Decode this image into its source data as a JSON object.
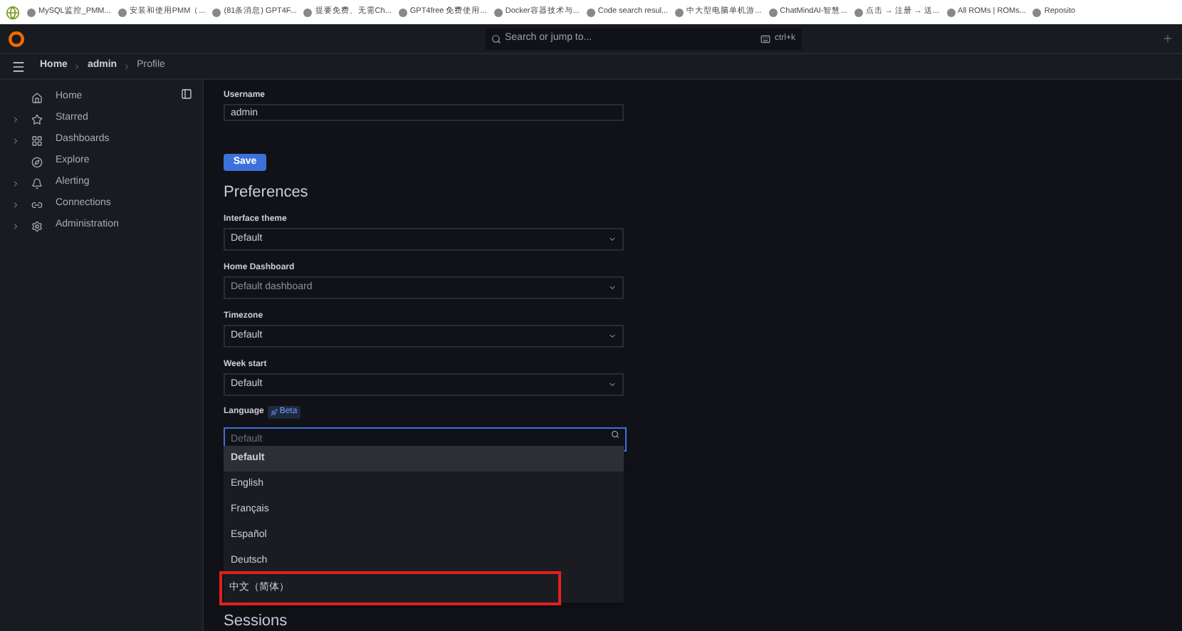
{
  "bookmarks": [
    {
      "label": "MySQL监控_PMM..."
    },
    {
      "label": "安装和使用PMM（..."
    },
    {
      "label": "(81条消息) GPT4F..."
    },
    {
      "label": "提要免费、无需Ch..."
    },
    {
      "label": "GPT4free 免费使用..."
    },
    {
      "label": "Docker容器技术与..."
    },
    {
      "label": "Code search resul..."
    },
    {
      "label": "中大型电脑单机游..."
    },
    {
      "label": "ChatMindAI-智慧..."
    },
    {
      "label": "点击 → 注册 → 送..."
    },
    {
      "label": "All ROMs | ROMs..."
    },
    {
      "label": "Reposito"
    }
  ],
  "search": {
    "placeholder": "Search or jump to...",
    "shortcut": "ctrl+k"
  },
  "breadcrumb": [
    {
      "label": "Home",
      "current": false
    },
    {
      "label": "admin",
      "current": false
    },
    {
      "label": "Profile",
      "current": true
    }
  ],
  "sidebar": {
    "items": [
      {
        "label": "Home",
        "expandable": false
      },
      {
        "label": "Starred",
        "expandable": true
      },
      {
        "label": "Dashboards",
        "expandable": true
      },
      {
        "label": "Explore",
        "expandable": false
      },
      {
        "label": "Alerting",
        "expandable": true
      },
      {
        "label": "Connections",
        "expandable": true
      },
      {
        "label": "Administration",
        "expandable": true
      }
    ]
  },
  "username": {
    "label": "Username",
    "value": "admin"
  },
  "save_button": "Save",
  "preferences": {
    "title": "Preferences",
    "fields": [
      {
        "label": "Interface theme",
        "value": "Default",
        "muted": false
      },
      {
        "label": "Home Dashboard",
        "value": "Default dashboard",
        "muted": true
      },
      {
        "label": "Timezone",
        "value": "Default",
        "muted": false
      },
      {
        "label": "Week start",
        "value": "Default",
        "muted": false
      }
    ]
  },
  "language": {
    "label": "Language",
    "badge": "Beta",
    "placeholder": "Default",
    "options": [
      {
        "label": "Default",
        "selected": true,
        "annotated": false
      },
      {
        "label": "English",
        "selected": false,
        "annotated": false
      },
      {
        "label": "Français",
        "selected": false,
        "annotated": false
      },
      {
        "label": "Español",
        "selected": false,
        "annotated": false
      },
      {
        "label": "Deutsch",
        "selected": false,
        "annotated": false
      },
      {
        "label": "中文（简体）",
        "selected": false,
        "annotated": true
      }
    ]
  },
  "sessions_title": "Sessions"
}
